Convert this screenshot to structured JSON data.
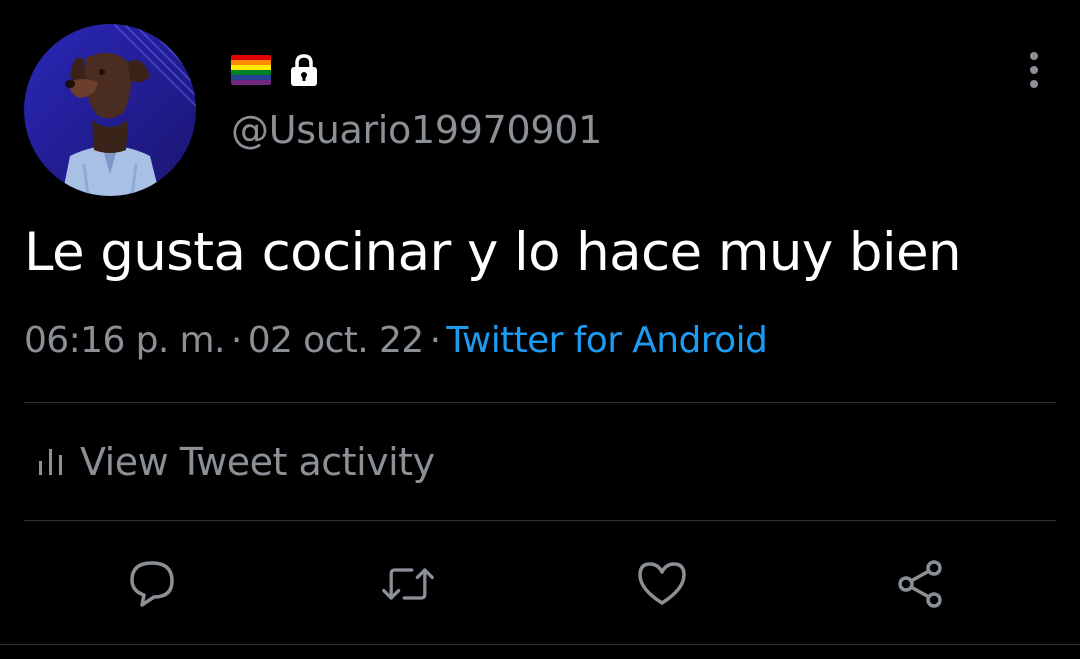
{
  "user": {
    "handle": "@Usuario19970901",
    "avatar_icon": "doberman-avatar",
    "flag_icon": "rainbow-flag-icon",
    "protected_icon": "lock-icon",
    "flag_colors": [
      "#e40303",
      "#ff8c00",
      "#ffed00",
      "#008026",
      "#24408e",
      "#732982"
    ]
  },
  "menu": {
    "icon": "more-vertical-icon"
  },
  "tweet": {
    "text": "Le gusta cocinar y lo hace muy bien",
    "time": "06:16 p. m.",
    "separator": "·",
    "date": "02 oct. 22",
    "source": "Twitter for Android"
  },
  "activity": {
    "label": "View Tweet activity",
    "icon": "analytics-bars-icon"
  },
  "actions": [
    {
      "name": "reply",
      "icon": "reply-bubble-icon"
    },
    {
      "name": "retweet",
      "icon": "retweet-arrows-icon"
    },
    {
      "name": "like",
      "icon": "heart-icon"
    },
    {
      "name": "share",
      "icon": "share-nodes-icon"
    }
  ],
  "colors": {
    "background": "#000000",
    "text_primary": "#ffffff",
    "text_secondary": "#8b9096",
    "link": "#1d9bf0",
    "divider": "#2f3336"
  }
}
